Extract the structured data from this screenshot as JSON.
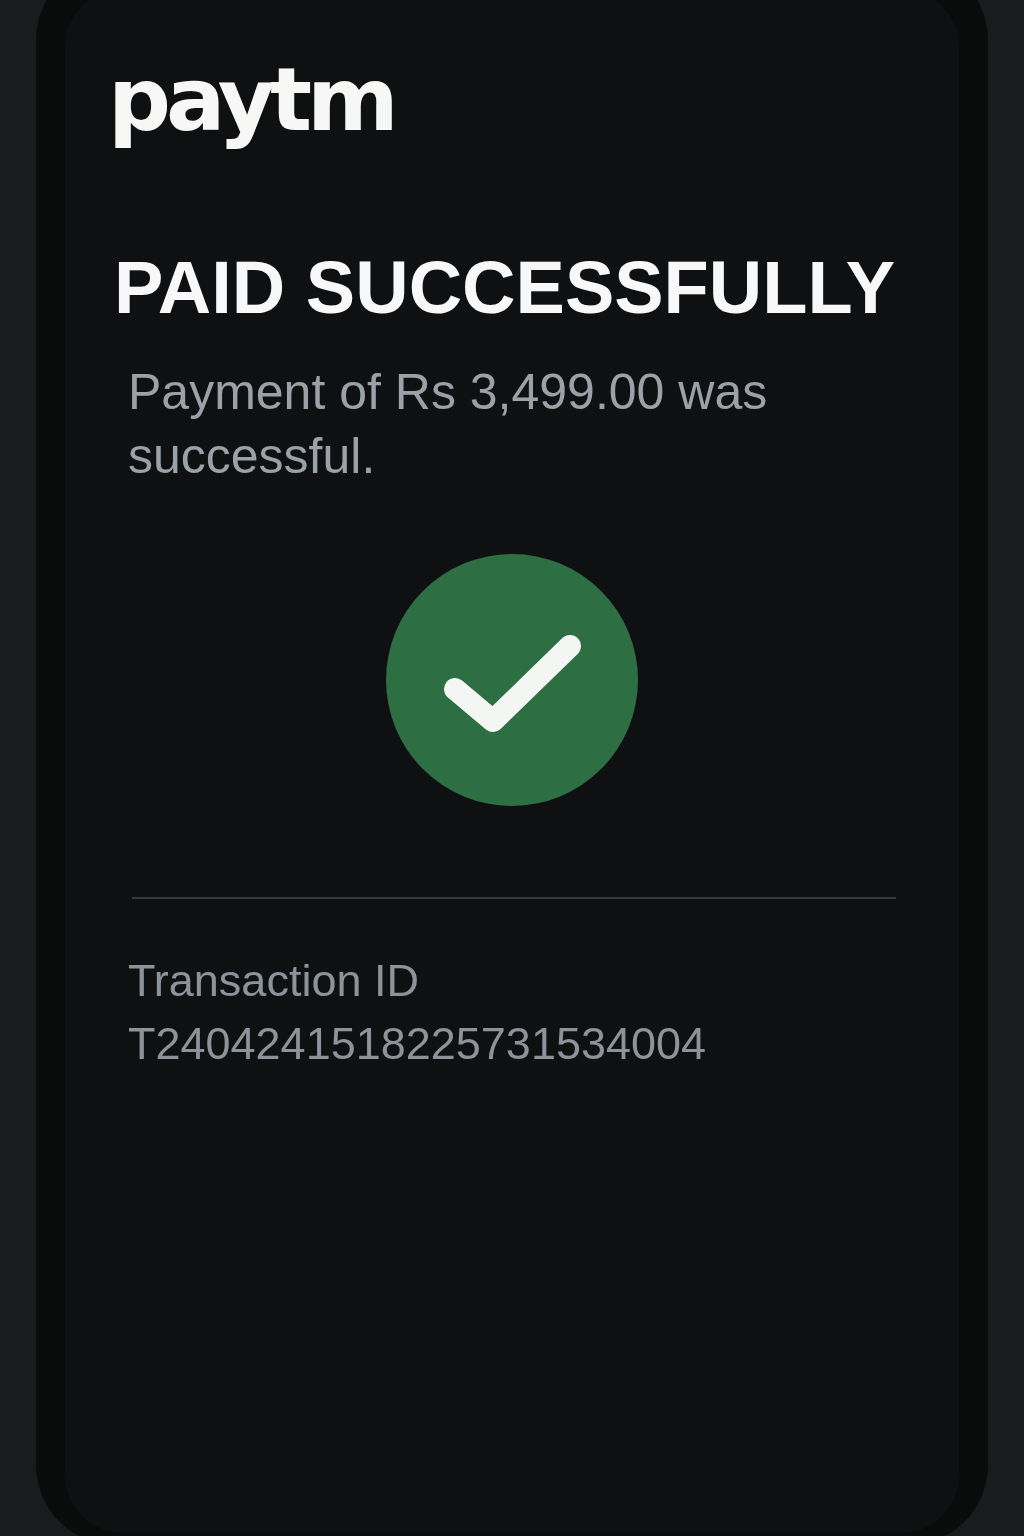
{
  "logo": {
    "text": "paytm"
  },
  "status": {
    "title": "PAID SUCCESSFULLY",
    "message": "Payment of Rs 3,499.00 was successful.",
    "success": true
  },
  "transaction": {
    "label": "Transaction ID",
    "value": "T2404241518225731534004"
  }
}
